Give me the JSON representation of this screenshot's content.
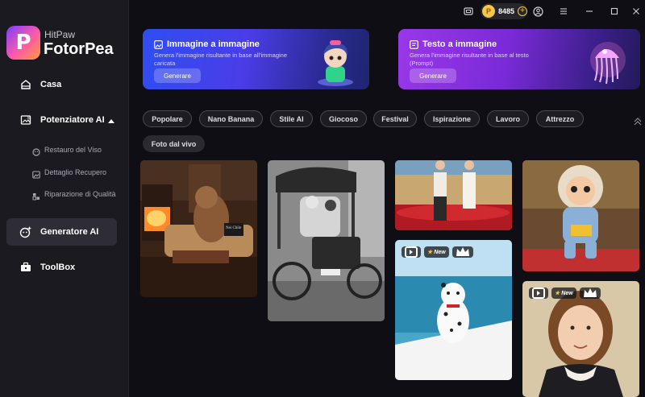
{
  "brand": {
    "top": "HitPaw",
    "name": "FotorPea"
  },
  "nav": {
    "home": "Casa",
    "enhancer": "Potenziatore AI",
    "sub": [
      "Restauro del Viso",
      "Dettaglio Recupero",
      "Riparazione di Qualità"
    ],
    "generator": "Generatore AI",
    "toolbox": "ToolBox"
  },
  "topbar": {
    "credits": "8485"
  },
  "banners": [
    {
      "title": "Immagine a immagine",
      "desc": "Genera l'immagine risultante in base all'immagine caricata",
      "button": "Generare"
    },
    {
      "title": "Testo a immagine",
      "desc": "Genera l'immagine risultante in base al testo (Prompt)",
      "button": "Generare"
    }
  ],
  "filters": [
    "Popolare",
    "Nano Banana",
    "Stile AI",
    "Giocoso",
    "Festival",
    "Ispirazione",
    "Lavoro",
    "Attrezzo",
    "Foto dal vivo"
  ],
  "cards": {
    "capybara_sign": "Nei Chile",
    "new_tag": "New"
  },
  "colors": {
    "sidebar": "#1b1a20",
    "background": "#0f0e14",
    "banner1": "#3a45ec",
    "banner2": "#8a30e0",
    "coin": "#f4c64a"
  }
}
